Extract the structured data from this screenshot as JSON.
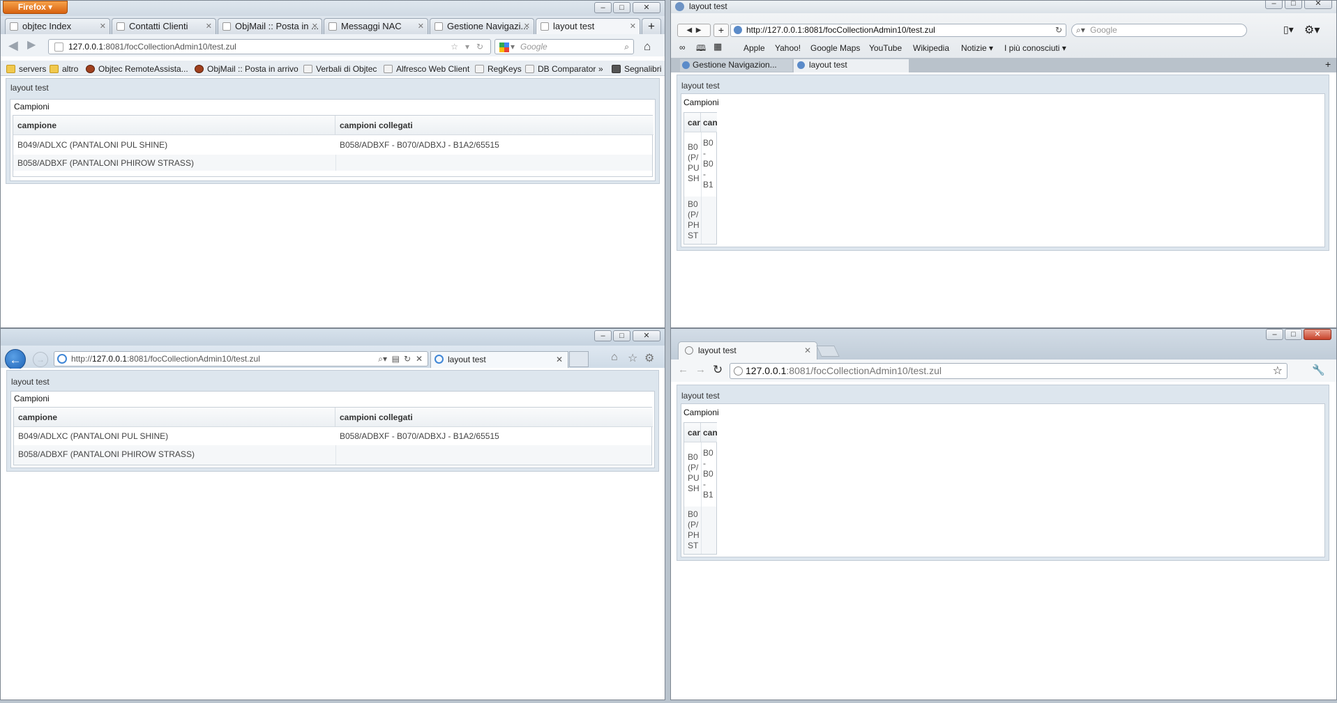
{
  "url": {
    "host": "127.0.0.1",
    "path": ":8081/focCollectionAdmin10/test.zul",
    "full": "http://127.0.0.1:8081/focCollectionAdmin10/test.zul",
    "ie_prefix": "http://",
    "ie_host": "127.0.0.1",
    "ie_path": ":8081/focCollectionAdmin10/test.zul"
  },
  "firefox": {
    "menu_label": "Firefox",
    "tabs": [
      "objtec Index",
      "Contatti Clienti",
      "ObjMail :: Posta in ...",
      "Messaggi NAC",
      "Gestione Navigazi...",
      "layout test"
    ],
    "search_placeholder": "Google",
    "bookmarks": [
      "servers",
      "altro",
      "Objtec RemoteAssista...",
      "ObjMail :: Posta in arrivo",
      "Verbali di Objtec",
      "Alfresco Web Client",
      "RegKeys",
      "DB Comparator",
      "»",
      "Segnalibri"
    ]
  },
  "safari": {
    "title": "layout test",
    "search_placeholder": "Google",
    "bookmarks": [
      "Apple",
      "Yahoo!",
      "Google Maps",
      "YouTube",
      "Wikipedia",
      "Notizie ▾",
      "I più conosciuti ▾"
    ],
    "tabs": [
      "Gestione Navigazion...",
      "layout test"
    ]
  },
  "ie": {
    "tab": "layout test"
  },
  "chrome": {
    "tab": "layout test"
  },
  "app": {
    "window_title": "layout test",
    "panel_title": "Campioni",
    "columns": [
      "campione",
      "campioni collegati"
    ],
    "columns_truncated": [
      "can",
      "can"
    ],
    "rows": [
      {
        "campione": "B049/ADLXC (PANTALONI PUL SHINE)",
        "collegati": "B058/ADBXF - B070/ADBXJ - B1A2/65515"
      },
      {
        "campione": "B058/ADBXF (PANTALONI PHIROW STRASS)",
        "collegati": ""
      }
    ],
    "narrow_rows": [
      {
        "c1": "B0\n(P/\nPU\nSH",
        "c2": "B0\n-\nB0\n-\nB1"
      },
      {
        "c1": "B0\n(P/\nPH\nST",
        "c2": ""
      }
    ]
  }
}
